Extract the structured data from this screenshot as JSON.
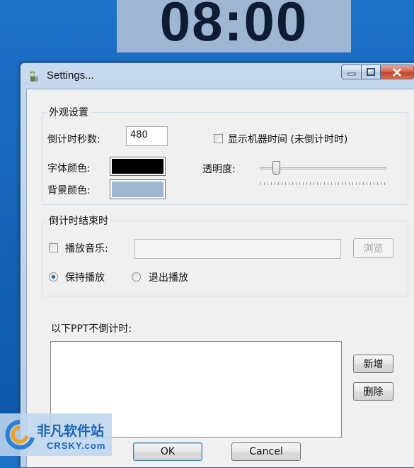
{
  "timer": {
    "display": "08:00",
    "bg_color": "#9fb6d3"
  },
  "window": {
    "title": "Settings..."
  },
  "appearance": {
    "group_label": "外观设置",
    "seconds_label": "倒计时秒数:",
    "seconds_value": "480",
    "show_machine_time_label": "显示机器时间 (未倒计时时)",
    "font_color_label": "字体颜色:",
    "font_color": "#000000",
    "bg_color_label": "背景颜色:",
    "bg_color": "#9fb6d3",
    "opacity_label": "透明度:",
    "opacity_level": 0.1
  },
  "end": {
    "group_label": "倒计时结束时",
    "play_music_label": "播放音乐:",
    "music_path": "",
    "browse_label": "浏览",
    "keep_playing_label": "保持播放",
    "exit_playing_label": "退出播放"
  },
  "exclusion": {
    "label": "以下PPT不倒计时:",
    "add_label": "新增",
    "delete_label": "删除"
  },
  "footer": {
    "ok_label": "OK",
    "cancel_label": "Cancel"
  },
  "watermark": {
    "line1": "非凡软件站",
    "line2": "CRSKY.com"
  }
}
